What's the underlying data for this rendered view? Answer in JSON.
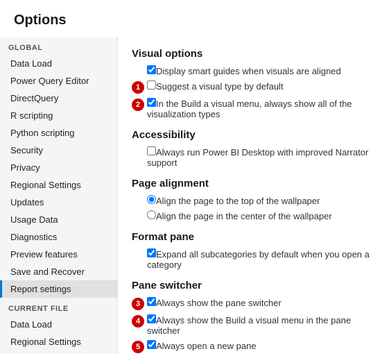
{
  "page": {
    "title": "Options"
  },
  "sidebar": {
    "global_label": "GLOBAL",
    "global_items": [
      {
        "label": "Data Load",
        "active": false
      },
      {
        "label": "Power Query Editor",
        "active": false
      },
      {
        "label": "DirectQuery",
        "active": false
      },
      {
        "label": "R scripting",
        "active": false
      },
      {
        "label": "Python scripting",
        "active": false
      },
      {
        "label": "Security",
        "active": false
      },
      {
        "label": "Privacy",
        "active": false
      },
      {
        "label": "Regional Settings",
        "active": false
      },
      {
        "label": "Updates",
        "active": false
      },
      {
        "label": "Usage Data",
        "active": false
      },
      {
        "label": "Diagnostics",
        "active": false
      },
      {
        "label": "Preview features",
        "active": false
      },
      {
        "label": "Save and Recover",
        "active": false
      },
      {
        "label": "Report settings",
        "active": true
      }
    ],
    "current_file_label": "CURRENT FILE",
    "current_file_items": [
      {
        "label": "Data Load",
        "active": false
      },
      {
        "label": "Regional Settings",
        "active": false
      }
    ]
  },
  "main": {
    "sections": [
      {
        "title": "Visual options",
        "options": [
          {
            "type": "checkbox",
            "checked": true,
            "badge": null,
            "label": "Display smart guides when visuals are aligned"
          },
          {
            "type": "checkbox",
            "checked": false,
            "badge": "1",
            "label": "Suggest a visual type by default"
          },
          {
            "type": "checkbox",
            "checked": true,
            "badge": "2",
            "label": "In the Build a visual menu, always show all of the visualization types"
          }
        ]
      },
      {
        "title": "Accessibility",
        "options": [
          {
            "type": "checkbox",
            "checked": false,
            "badge": null,
            "label": "Always run Power BI Desktop with improved Narrator support"
          }
        ]
      },
      {
        "title": "Page alignment",
        "options": [
          {
            "type": "radio",
            "checked": true,
            "badge": null,
            "label": "Align the page to the top of the wallpaper",
            "name": "page-align"
          },
          {
            "type": "radio",
            "checked": false,
            "badge": null,
            "label": "Align the page in the center of the wallpaper",
            "name": "page-align"
          }
        ]
      },
      {
        "title": "Format pane",
        "options": [
          {
            "type": "checkbox",
            "checked": true,
            "badge": null,
            "label": "Expand all subcategories by default when you open a category"
          }
        ]
      },
      {
        "title": "Pane switcher",
        "options": [
          {
            "type": "checkbox",
            "checked": true,
            "badge": "3",
            "label": "Always show the pane switcher"
          },
          {
            "type": "checkbox",
            "checked": true,
            "badge": "4",
            "label": "Always show the Build a visual menu in the pane switcher"
          },
          {
            "type": "checkbox",
            "checked": true,
            "badge": "5",
            "label": "Always open a new pane"
          }
        ]
      }
    ]
  }
}
